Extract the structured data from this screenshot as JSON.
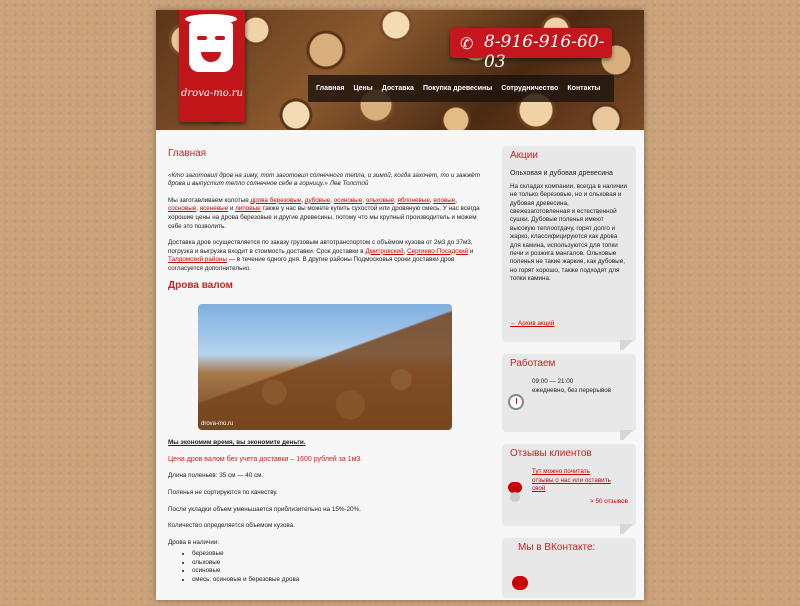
{
  "site": {
    "logo_text": "drova-mo.ru",
    "phone": "8-916-916-60-03"
  },
  "nav": [
    "Главная",
    "Цены",
    "Доставка",
    "Покупка древесины",
    "Сотрудничество",
    "Контакты"
  ],
  "main": {
    "title": "Главная",
    "quote": "«Кто заготовил дров на зиму, тот заготовил солнечного тепла, и зимой, когда захочет, то и зажжёт дрова и выпустит тепло солнечное себе в горницу.» Лев Толстой",
    "intro": {
      "start": "Мы заготавливаем колотые ",
      "links": [
        "дрова березовые",
        "дубовые",
        "осиновые",
        "ольховые",
        "яблоневые",
        "еловые",
        "сосновые",
        "ясеневые",
        "липовые"
      ],
      "end": " также у нас вы можете купить сухостой или дровяную смесь. У нас всегда хорошие цены на дрова березовые и другие древесины, потому что мы крупный производитель и можем себе это позволить."
    },
    "delivery": {
      "start": "Доставка дров осуществляется по заказу грузовым автотранспортом с объёмом кузова от 2м3 до 37м3, погрузка и выгрузка входит в стоимость доставки. Срок доставки в ",
      "link1": "Дмитровский",
      "link2": "Сергиево-Посадский",
      "mid": " и ",
      "link3": "Талдомский районы",
      "end": " — в течение одного дня. В другие районы Подмосковья сроки доставки дров согласуется дополнительно."
    },
    "section_title": "Дрова валом",
    "photo_watermark": "drova-mo.ru",
    "subheading": "Мы экономим время, вы экономите деньги.",
    "price": "Цена дров валом без учета доставки – 1600 рублей за 1м3.",
    "lines": [
      "Длина поленьев: 35 см — 40 см.",
      "Поленья не сортируются по качеству.",
      "После укладки объем уменьшается приблизительно на 15%-20%.",
      "Количество определяется объемом кузова."
    ],
    "stock_title": "Дрова в наличии:",
    "stock": [
      "березовые",
      "ольховые",
      "осиновые",
      "смесь: осиновые и березовые дрова"
    ]
  },
  "sidebar": {
    "promo": {
      "title": "Акции",
      "subtitle": "Ольховая и дубовая древесина",
      "text": "На складах компании, всегда в наличии не только березовые, но и ольховая и дубовая древесина, свежезаготовленная и естественной сушки. Дубовые поленья имеют высокую теплоотдачу, горят долго и жарко, классифицируются как дрова для камина, используются для топки печи и розжига мангалов. Ольховые поленья не такие жаркие, как дубовые, но горят хорошо, также подходят для топки камина.",
      "archive": "← Архив акций"
    },
    "hours": {
      "title": "Работаем",
      "time": "09:00 — 21:00",
      "days": "ежедневно, без перерывов"
    },
    "reviews": {
      "title": "Отзывы клиентов",
      "link": "Тут можно почитать отзывы о нас или оставить свой",
      "count": "> 50 отзывов"
    },
    "vk": {
      "title": "Мы в ВКонтакте:"
    }
  }
}
